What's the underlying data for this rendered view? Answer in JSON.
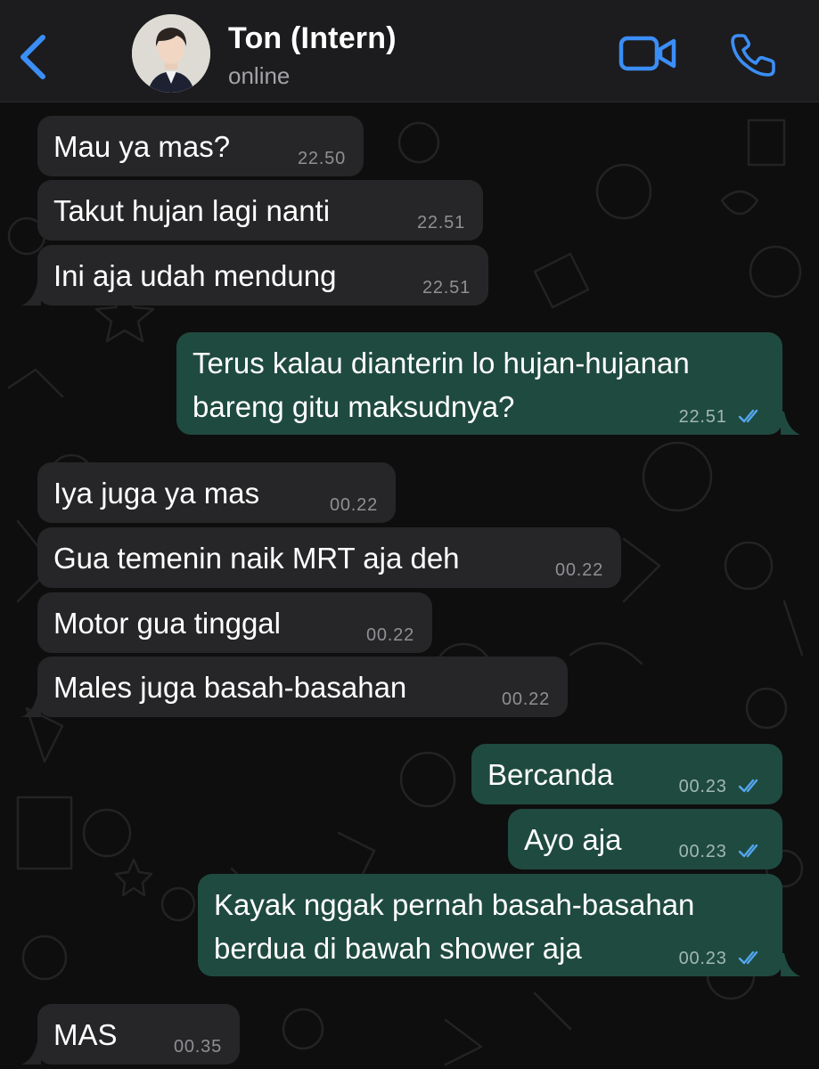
{
  "header": {
    "back_icon": "chevron-left-icon",
    "contact_name": "Ton (Intern)",
    "status": "online",
    "video_icon": "video-camera-icon",
    "call_icon": "phone-icon",
    "accent_color": "#3b8ef5"
  },
  "chat": {
    "colors": {
      "incoming_bubble": "#262628",
      "outgoing_bubble": "#1f4a3f",
      "read_ticks": "#53a6f0"
    },
    "messages": [
      {
        "direction": "incoming",
        "text": "Mau ya mas?",
        "time": "22.50"
      },
      {
        "direction": "incoming",
        "text": "Takut hujan lagi nanti",
        "time": "22.51"
      },
      {
        "direction": "incoming",
        "text": "Ini aja udah mendung",
        "time": "22.51"
      },
      {
        "direction": "outgoing",
        "text": "Terus kalau dianterin lo hujan-hujanan bareng gitu maksudnya?",
        "time": "22.51",
        "read": true
      },
      {
        "direction": "incoming",
        "text": "Iya juga ya mas",
        "time": "00.22"
      },
      {
        "direction": "incoming",
        "text": "Gua temenin naik MRT aja deh",
        "time": "00.22"
      },
      {
        "direction": "incoming",
        "text": "Motor gua tinggal",
        "time": "00.22"
      },
      {
        "direction": "incoming",
        "text": "Males juga basah-basahan",
        "time": "00.22"
      },
      {
        "direction": "outgoing",
        "text": "Bercanda",
        "time": "00.23",
        "read": true
      },
      {
        "direction": "outgoing",
        "text": "Ayo aja",
        "time": "00.23",
        "read": true
      },
      {
        "direction": "outgoing",
        "text": "Kayak nggak pernah basah-basahan berdua di bawah shower aja",
        "time": "00.23",
        "read": true
      },
      {
        "direction": "incoming",
        "text": "MAS",
        "time": "00.35"
      }
    ]
  }
}
